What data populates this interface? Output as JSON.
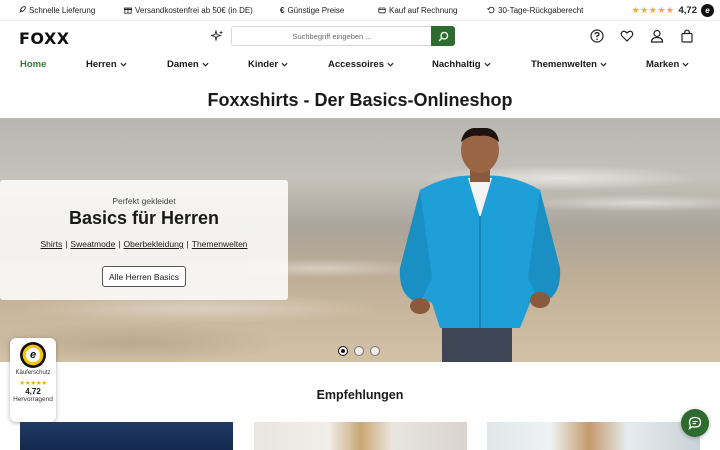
{
  "usp_bar": {
    "items": [
      "Schnelle Lieferung",
      "Versandkostenfrei ab 50€ (in DE)",
      "Günstige Preise",
      "Kauf auf Rechnung",
      "30-Tage-Rückgaberecht"
    ],
    "rating_stars": "★★★★★",
    "rating_value": "4,72",
    "trust_letter": "e"
  },
  "header": {
    "logo": "FOXX",
    "search_placeholder": "Suchbegriff eingeben ...",
    "icons": [
      "sparkle-icon",
      "search-icon",
      "help-icon",
      "heart-icon",
      "user-icon",
      "cart-icon"
    ]
  },
  "nav": {
    "items": [
      "Home",
      "Herren",
      "Damen",
      "Kinder",
      "Accessoires",
      "Nachhaltig",
      "Themenwelten",
      "Marken"
    ],
    "active": "Home"
  },
  "page_title": "Foxxshirts - Der Basics-Onlineshop",
  "hero": {
    "subtitle": "Perfekt gekleidet",
    "title": "Basics für Herren",
    "links": [
      "Shirts",
      "Sweatmode",
      "Oberbekleidung",
      "Themenwelten"
    ],
    "cta": "Alle Herren Basics",
    "slide_count": 3,
    "active_slide": 1
  },
  "trust_badge": {
    "label": "Käuferschutz",
    "stars": "★★★★★",
    "score": "4,72",
    "verdict": "Hervorragend"
  },
  "recommendations": {
    "title": "Empfehlungen"
  },
  "colors": {
    "brand_green": "#2e6b2e",
    "active_nav": "#2e7d32",
    "star": "#f0a830"
  }
}
